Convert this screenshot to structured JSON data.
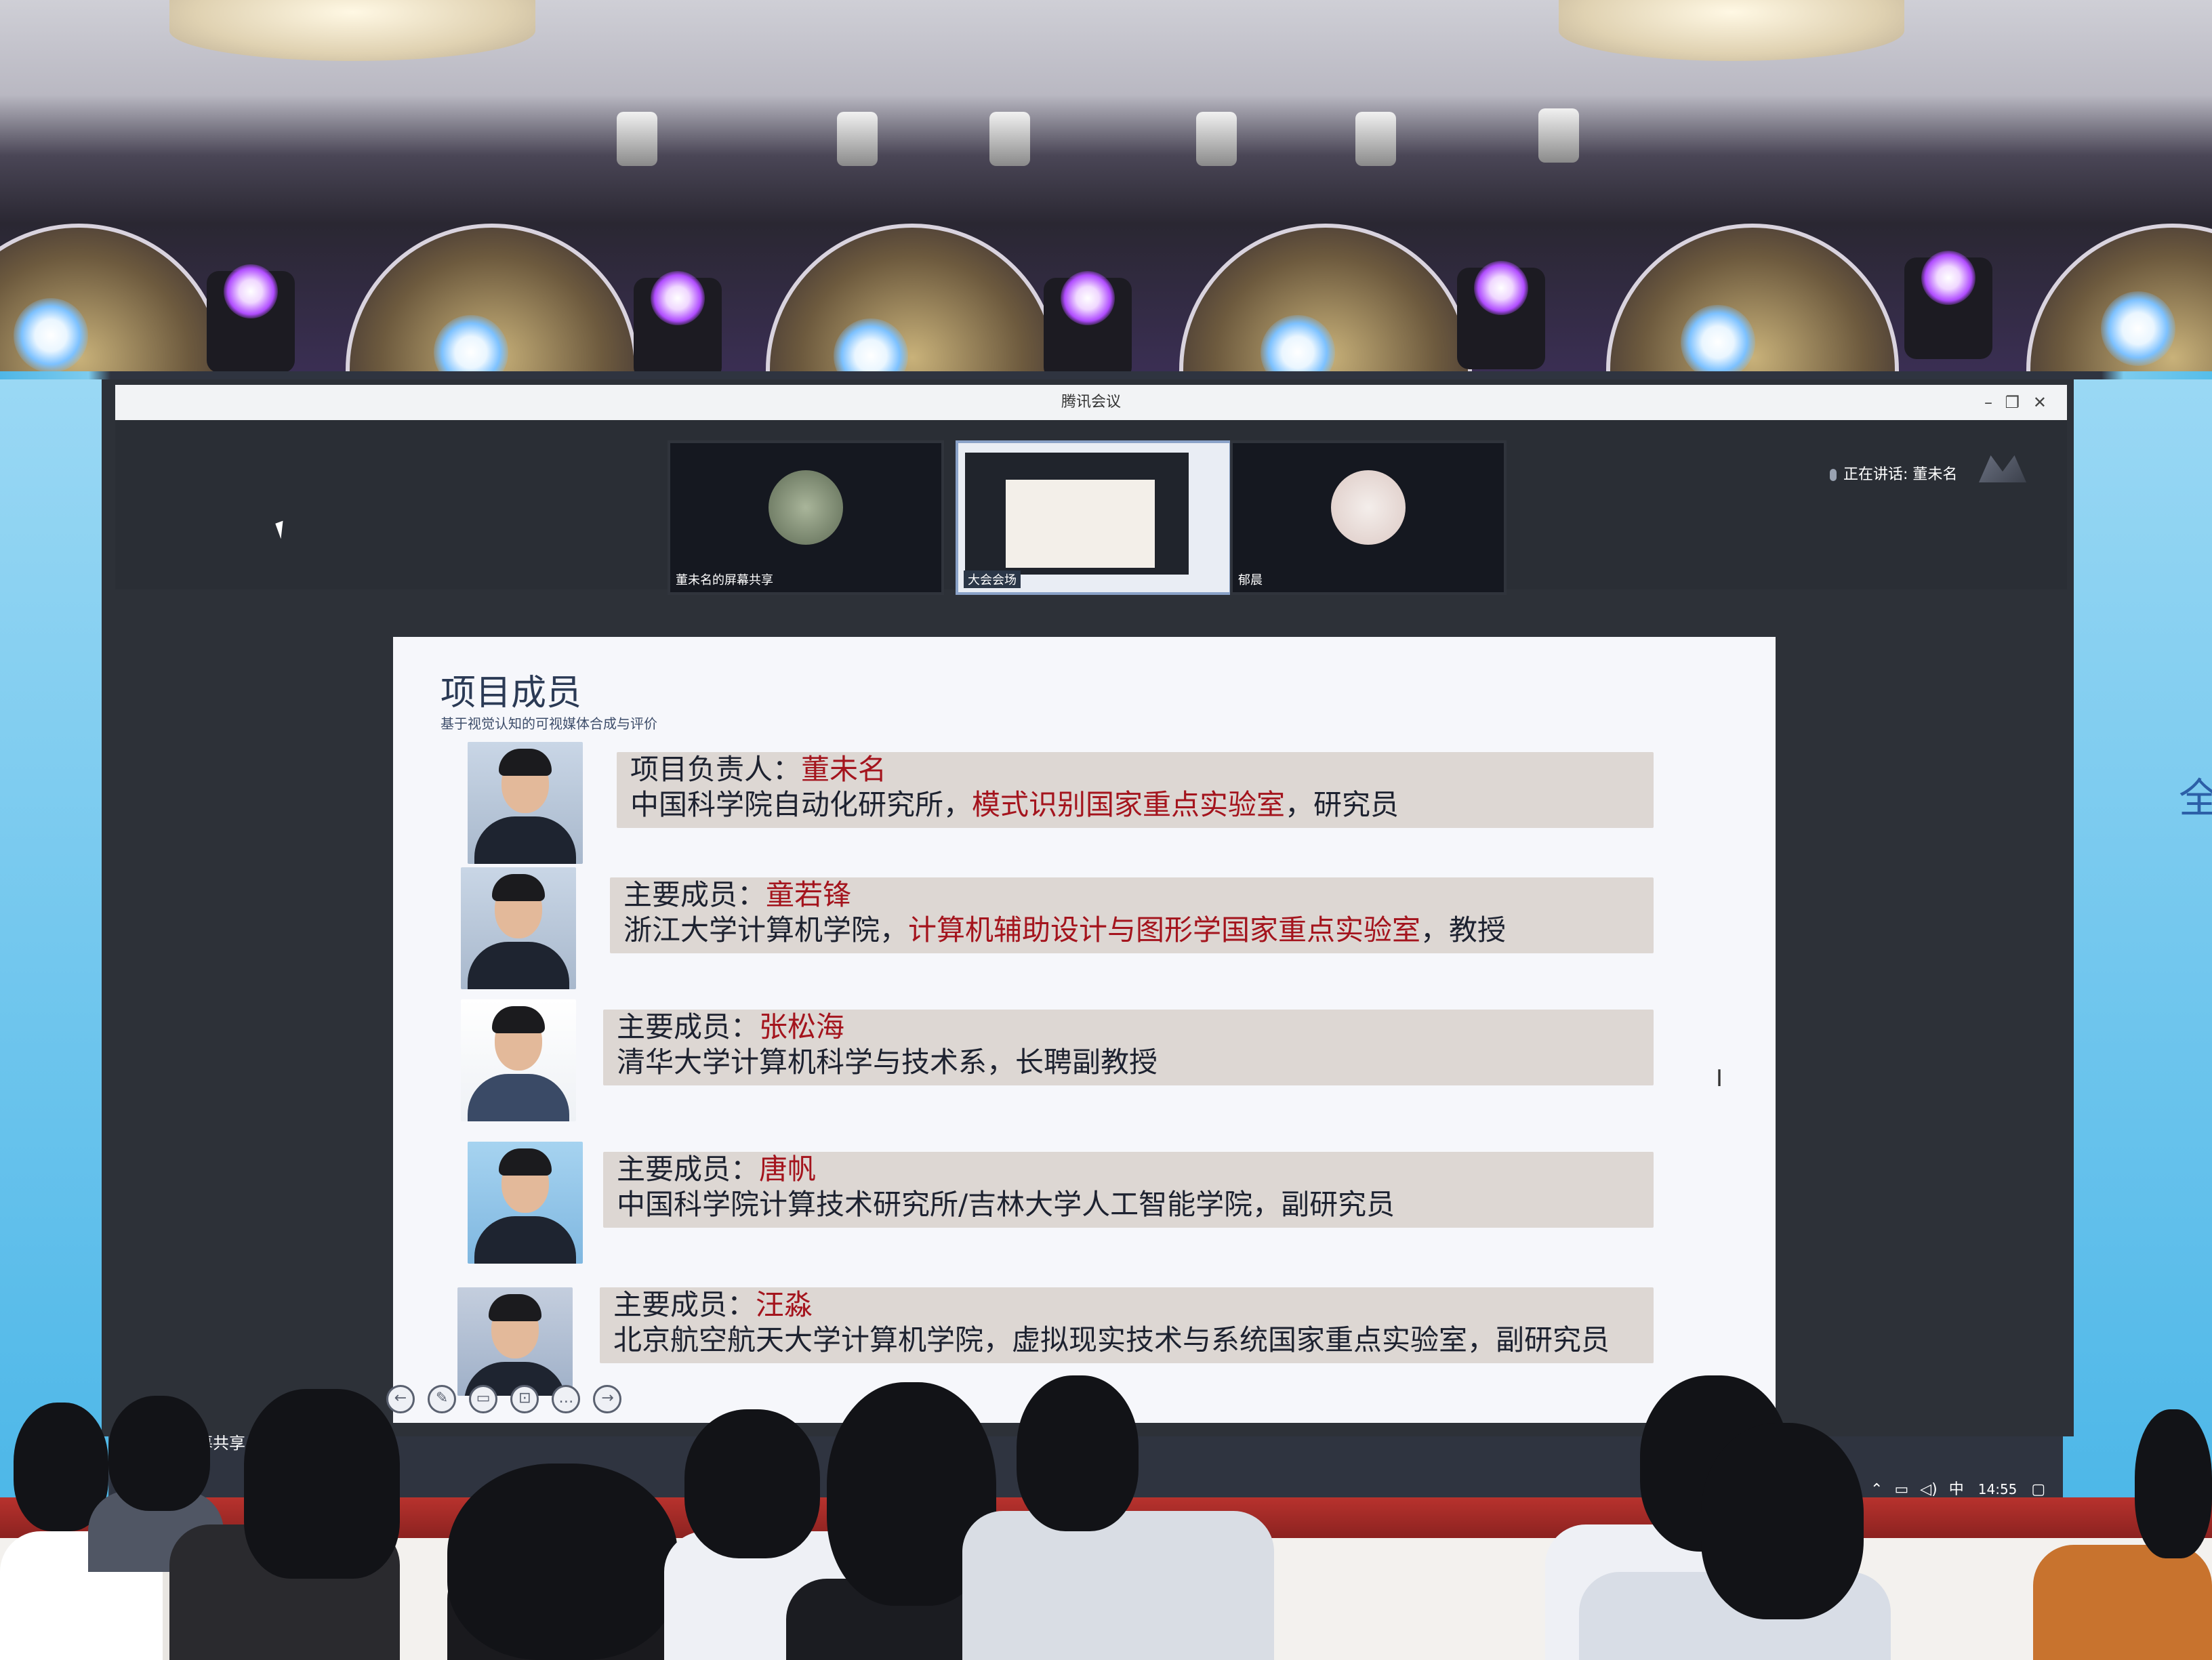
{
  "window": {
    "title": "腾讯会议",
    "speaking_label": "正在讲话: 董未名"
  },
  "video_tiles": [
    {
      "label": "董未名的屏幕共享",
      "avatar_color": "#7a8a6e"
    },
    {
      "label": "大会会场",
      "avatar_color": "#5a6d8a"
    },
    {
      "label": "郁晨",
      "avatar_color": "#e8e0dc"
    }
  ],
  "slide": {
    "title": "项目成员",
    "subtitle": "基于视觉认知的可视媒体合成与评价",
    "members": [
      {
        "role": "项目负责人：",
        "name": "董未名",
        "affil_prefix": "中国科学院自动化研究所，",
        "affil_red": "模式识别国家重点实验室",
        "affil_suffix": "，研究员"
      },
      {
        "role": "主要成员：",
        "name": "童若锋",
        "affil_prefix": "浙江大学计算机学院，",
        "affil_red": "计算机辅助设计与图形学国家重点实验室",
        "affil_suffix": "，教授"
      },
      {
        "role": "主要成员：",
        "name": "张松海",
        "affil_prefix": "清华大学计算机科学与技术系，长聘副教授",
        "affil_red": "",
        "affil_suffix": ""
      },
      {
        "role": "主要成员：",
        "name": "唐帆",
        "affil_prefix": "中国科学院计算技术研究所/吉林大学人工智能学院，副研究员",
        "affil_red": "",
        "affil_suffix": ""
      },
      {
        "role": "主要成员：",
        "name": "汪淼",
        "affil_prefix": "北京航空航天大学计算机学院，虚拟现实技术与系统国家重点实验室，副研究员",
        "affil_red": "",
        "affil_suffix": ""
      }
    ]
  },
  "share_toolbar_label": "幕共享",
  "taskbar": {
    "ime": "中",
    "time": "14:55"
  },
  "side_glyph": "全",
  "colors": {
    "accent_red": "#a4141d",
    "slide_bg": "#f6f7fb",
    "info_box": "#ddd7d3"
  }
}
